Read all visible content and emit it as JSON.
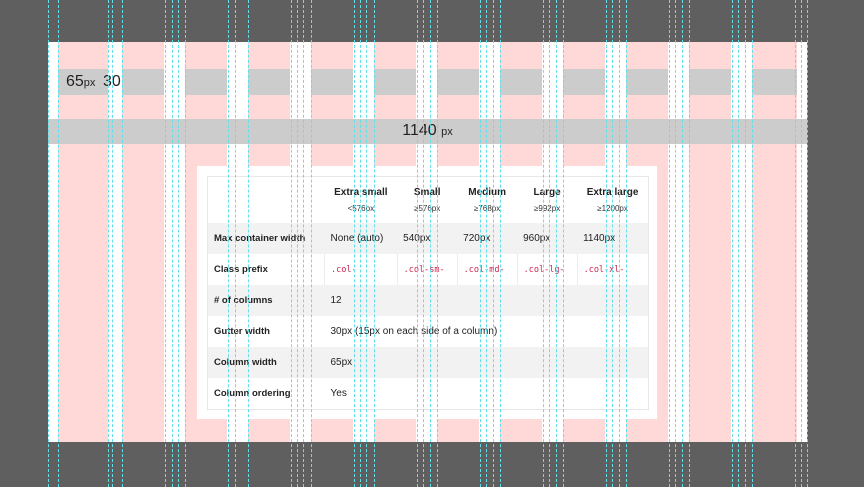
{
  "grid": {
    "column_width_value": "65",
    "column_width_unit": "px",
    "gutter_value": "30",
    "container_value": "1140",
    "container_unit": "px"
  },
  "table": {
    "headers": [
      {
        "label": "",
        "sub": ""
      },
      {
        "label": "Extra small",
        "sub": "<576px"
      },
      {
        "label": "Small",
        "sub": "≥576px"
      },
      {
        "label": "Medium",
        "sub": "≥768px"
      },
      {
        "label": "Large",
        "sub": "≥992px"
      },
      {
        "label": "Extra large",
        "sub": "≥1200px"
      }
    ],
    "rows": {
      "max_container": {
        "label": "Max container width",
        "values": [
          "None (auto)",
          "540px",
          "720px",
          "960px",
          "1140px"
        ]
      },
      "class_prefix": {
        "label": "Class prefix",
        "values": [
          ".col-",
          ".col-sm-",
          ".col-md-",
          ".col-lg-",
          ".col-xl-"
        ]
      },
      "columns": {
        "label": "# of columns",
        "value": "12"
      },
      "gutter": {
        "label": "Gutter width",
        "value": "30px (15px on each side of a column)"
      },
      "column_width": {
        "label": "Column width",
        "value": "65px"
      },
      "ordering": {
        "label": "Column ordering",
        "value": "Yes"
      }
    }
  },
  "colors": {
    "background": "#5f5f5f",
    "column_stripe": "#ffd8d8",
    "band": "#cccccc",
    "guide": "#5fe0ea",
    "code": "#c7254e"
  }
}
